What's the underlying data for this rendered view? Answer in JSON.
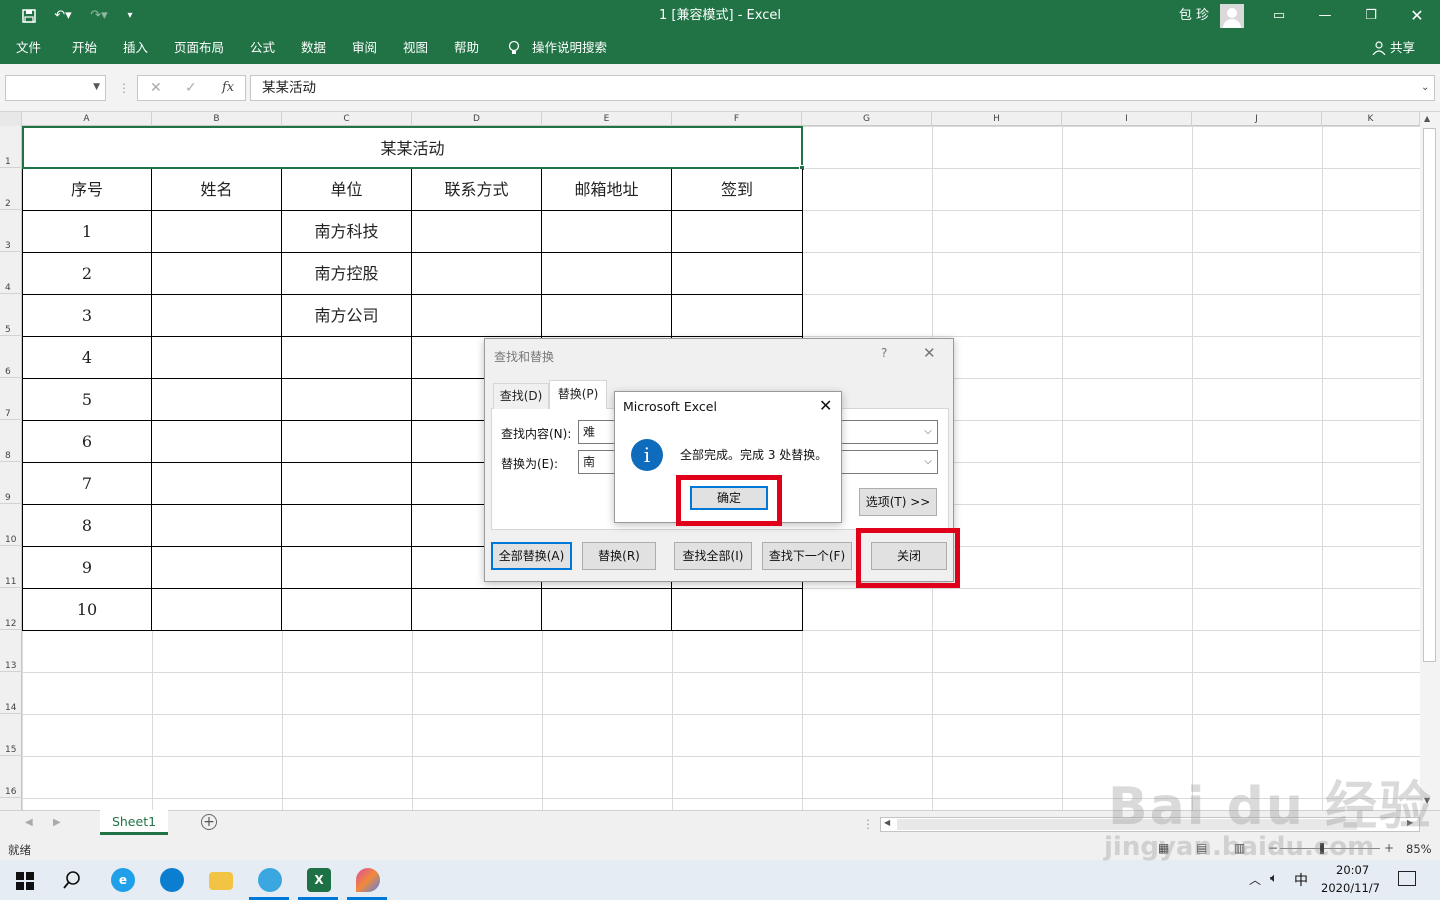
{
  "titlebar": {
    "doc_title": "1  [兼容模式]  -  Excel",
    "user": "包 珍"
  },
  "ribbon": {
    "tabs": [
      "文件",
      "开始",
      "插入",
      "页面布局",
      "公式",
      "数据",
      "审阅",
      "视图",
      "帮助"
    ],
    "tell_me": "操作说明搜索",
    "share": "共享"
  },
  "formula_bar": {
    "fx": "fx",
    "content": "某某活动"
  },
  "columns": [
    "A",
    "B",
    "C",
    "D",
    "E",
    "F",
    "G",
    "H",
    "I",
    "J",
    "K"
  ],
  "rows": [
    "1",
    "2",
    "3",
    "4",
    "5",
    "6",
    "7",
    "8",
    "9",
    "10",
    "11",
    "12",
    "13",
    "14",
    "15",
    "16"
  ],
  "sheet": {
    "title": "某某活动",
    "headers": [
      "序号",
      "姓名",
      "单位",
      "联系方式",
      "邮箱地址",
      "签到"
    ],
    "seq": [
      "1",
      "2",
      "3",
      "4",
      "5",
      "6",
      "7",
      "8",
      "9",
      "10"
    ],
    "units": [
      "南方科技",
      "南方控股",
      "南方公司"
    ]
  },
  "find_replace": {
    "title": "查找和替换",
    "help": "?",
    "tab_find": "查找(D)",
    "tab_replace": "替换(P)",
    "find_label": "查找内容(N):",
    "find_value": "难",
    "replace_label": "替换为(E):",
    "replace_value": "南",
    "options": "选项(T) >>",
    "replace_all": "全部替换(A)",
    "replace": "替换(R)",
    "find_all": "查找全部(I)",
    "find_next": "查找下一个(F)",
    "close": "关闭"
  },
  "msgbox": {
    "title": "Microsoft Excel",
    "message": "全部完成。完成 3 处替换。",
    "ok": "确定"
  },
  "sheet_tabs": {
    "active": "Sheet1"
  },
  "status": {
    "ready": "就绪",
    "zoom": "85%"
  },
  "taskbar": {
    "ime": "中",
    "time": "20:07",
    "date": "2020/11/7"
  },
  "watermark": {
    "top": "Bai du 经验",
    "bottom": "jingyan.baidu.com"
  },
  "colors": {
    "excel_green": "#217346",
    "highlight_red": "#e0001a",
    "info_blue": "#0f6cbd"
  }
}
